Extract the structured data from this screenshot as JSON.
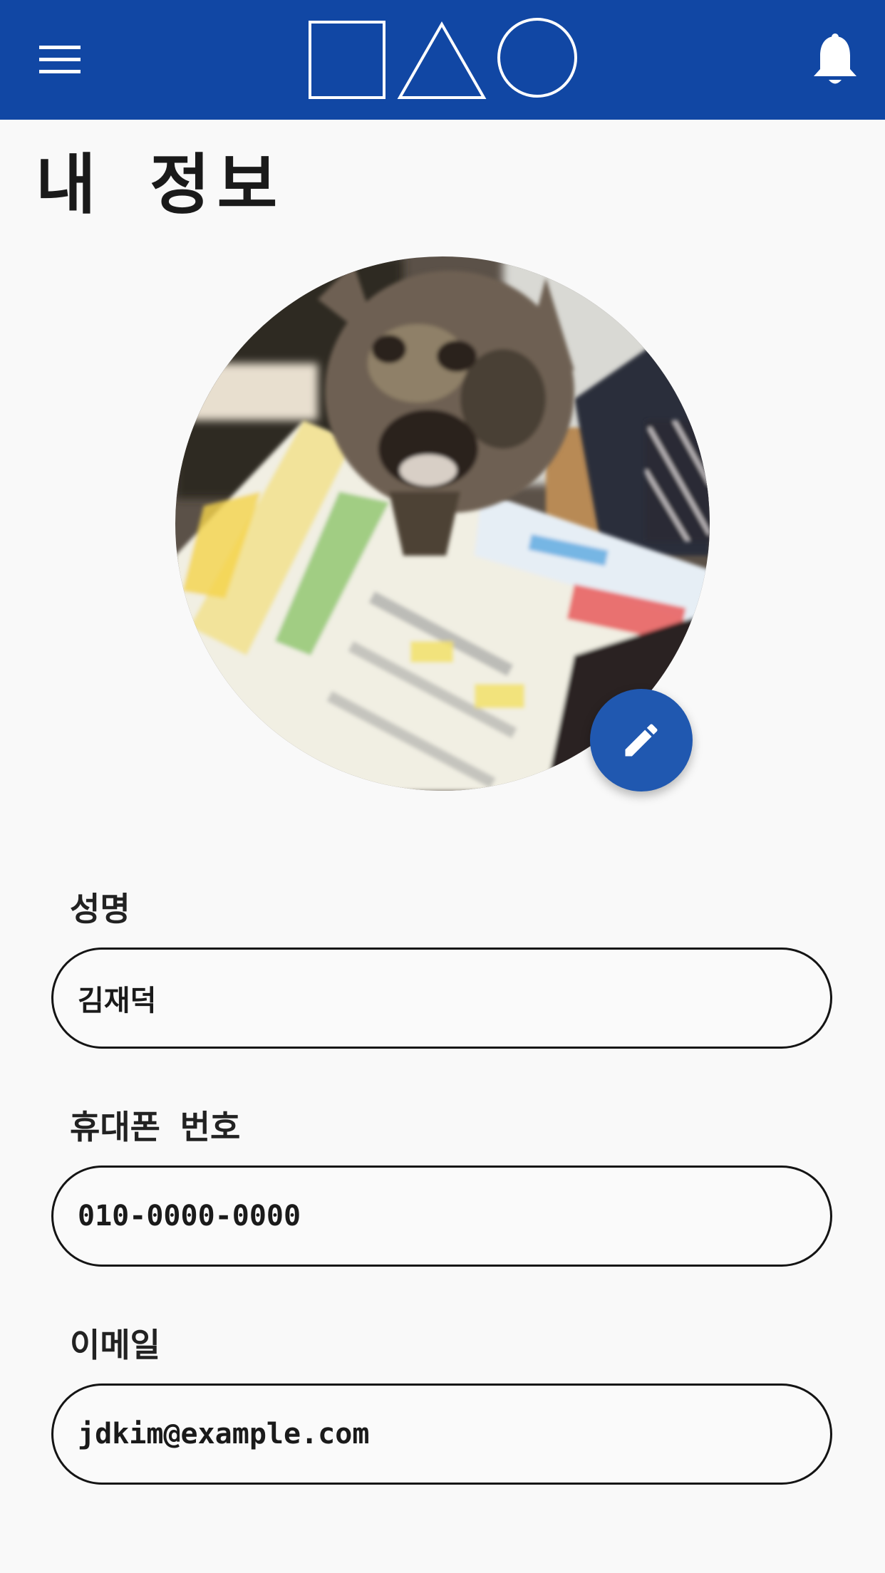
{
  "header": {
    "menu_icon": "hamburger-menu-icon",
    "logo_shapes": [
      "square",
      "triangle",
      "circle"
    ],
    "notification_icon": "bell-icon",
    "bar_color": "#1147a4"
  },
  "page": {
    "title": "내 정보"
  },
  "profile": {
    "avatar": "cat-photo",
    "edit_icon": "pencil-icon",
    "edit_button_color": "#2058b0"
  },
  "form": {
    "name": {
      "label": "성명",
      "value": "김재덕"
    },
    "phone": {
      "label": "휴대폰 번호",
      "value": "010-0000-0000"
    },
    "email": {
      "label": "이메일",
      "value": "jdkim@example.com"
    }
  }
}
